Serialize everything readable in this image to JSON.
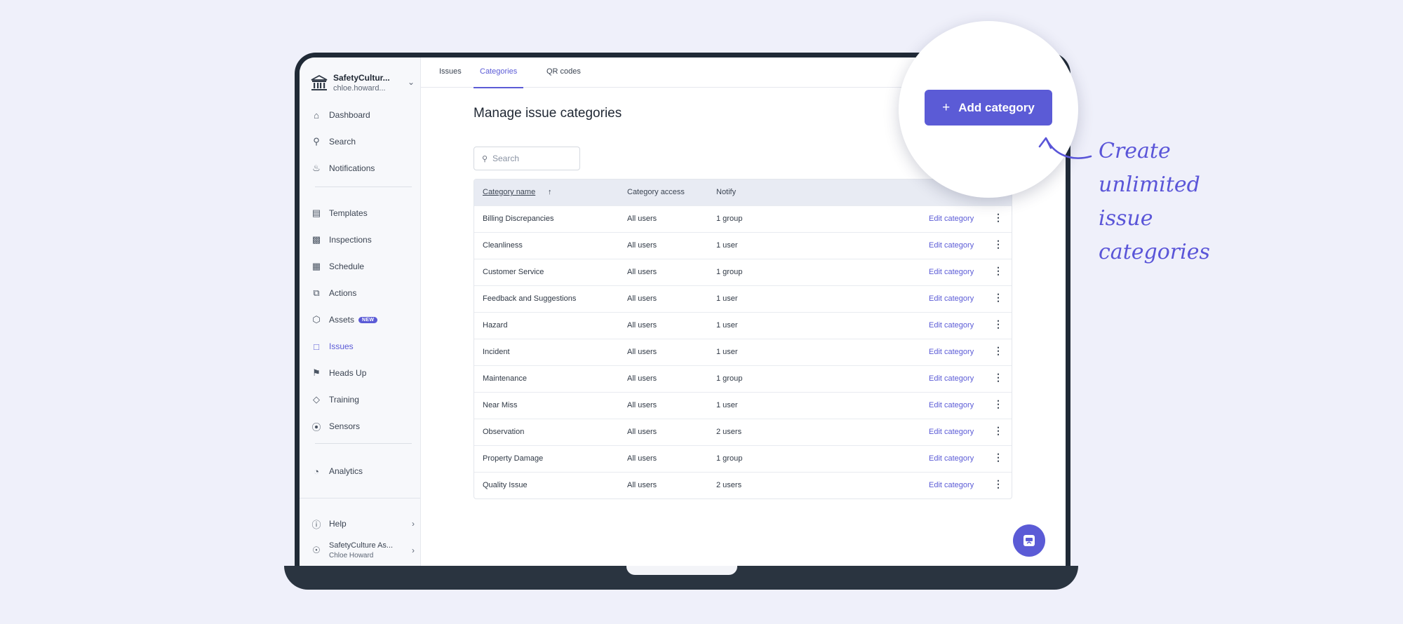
{
  "org": {
    "name": "SafetyCultur...",
    "user": "chloe.howard..."
  },
  "nav": {
    "dashboard": "Dashboard",
    "search": "Search",
    "notifications": "Notifications",
    "templates": "Templates",
    "inspections": "Inspections",
    "schedule": "Schedule",
    "actions": "Actions",
    "assets": "Assets",
    "assets_badge": "NEW",
    "issues": "Issues",
    "heads_up": "Heads Up",
    "training": "Training",
    "sensors": "Sensors",
    "analytics": "Analytics",
    "help": "Help",
    "account_name": "SafetyCulture As...",
    "account_user": "Chloe Howard"
  },
  "tabs": [
    "Issues",
    "Categories",
    "QR codes"
  ],
  "page": {
    "title": "Manage issue categories",
    "add_button": "Add category",
    "search_placeholder": "Search"
  },
  "table": {
    "headers": [
      "Category name",
      "Category access",
      "Notify"
    ],
    "edit_label": "Edit category",
    "rows": [
      [
        "Billing Discrepancies",
        "All users",
        "1 group"
      ],
      [
        "Cleanliness",
        "All users",
        "1 user"
      ],
      [
        "Customer Service",
        "All users",
        "1 group"
      ],
      [
        "Feedback and Suggestions",
        "All users",
        "1 user"
      ],
      [
        "Hazard",
        "All users",
        "1 user"
      ],
      [
        "Incident",
        "All users",
        "1 user"
      ],
      [
        "Maintenance",
        "All users",
        "1 group"
      ],
      [
        "Near Miss",
        "All users",
        "1 user"
      ],
      [
        "Observation",
        "All users",
        "2 users"
      ],
      [
        "Property Damage",
        "All users",
        "1 group"
      ],
      [
        "Quality Issue",
        "All users",
        "2 users"
      ]
    ]
  },
  "annotation": {
    "line1": "Create unlimited",
    "line2": "issue categories"
  },
  "colors": {
    "accent": "#5b5bd6",
    "background": "#eff0fa",
    "bezel": "#202a36"
  }
}
